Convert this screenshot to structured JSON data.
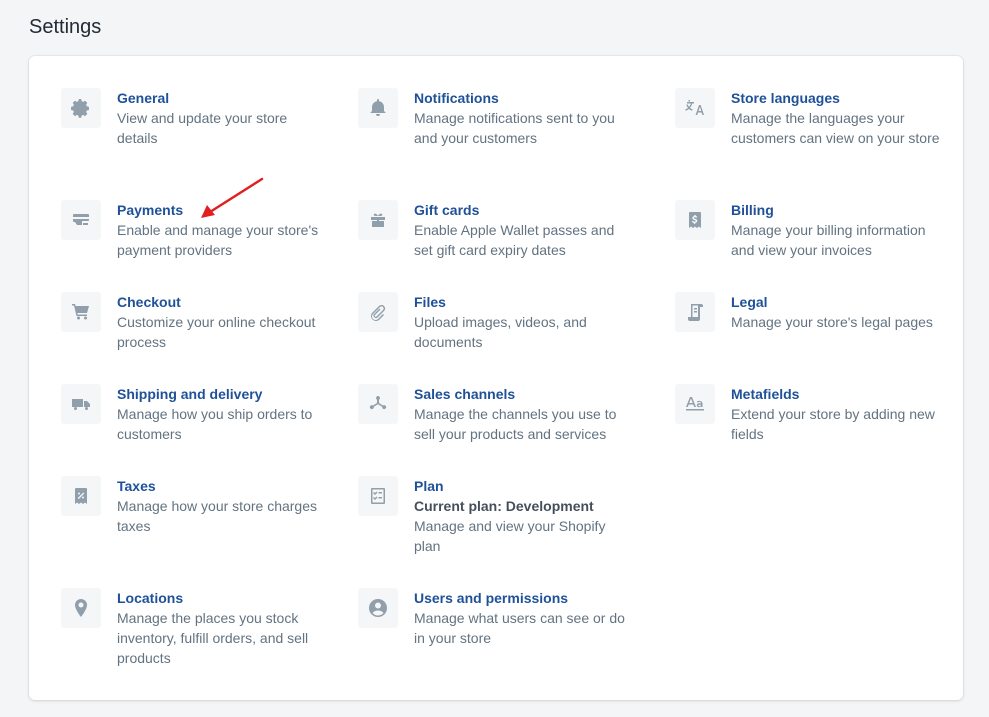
{
  "page": {
    "title": "Settings"
  },
  "items": [
    {
      "key": "general",
      "title": "General",
      "desc": "View and update your store details",
      "icon": "gear-icon"
    },
    {
      "key": "notifications",
      "title": "Notifications",
      "desc": "Manage notifications sent to you and your customers",
      "icon": "bell-icon"
    },
    {
      "key": "store-languages",
      "title": "Store languages",
      "desc": "Manage the languages your customers can view on your store",
      "icon": "translate-icon"
    },
    {
      "key": "payments",
      "title": "Payments",
      "desc": "Enable and manage your store's payment providers",
      "icon": "credit-card-icon"
    },
    {
      "key": "gift-cards",
      "title": "Gift cards",
      "desc": "Enable Apple Wallet passes and set gift card expiry dates",
      "icon": "gift-icon"
    },
    {
      "key": "billing",
      "title": "Billing",
      "desc": "Manage your billing information and view your invoices",
      "icon": "invoice-dollar-icon"
    },
    {
      "key": "checkout",
      "title": "Checkout",
      "desc": "Customize your online checkout process",
      "icon": "cart-icon"
    },
    {
      "key": "files",
      "title": "Files",
      "desc": "Upload images, videos, and documents",
      "icon": "paperclip-icon"
    },
    {
      "key": "legal",
      "title": "Legal",
      "desc": "Manage your store's legal pages",
      "icon": "legal-document-icon"
    },
    {
      "key": "shipping",
      "title": "Shipping and delivery",
      "desc": "Manage how you ship orders to customers",
      "icon": "truck-icon"
    },
    {
      "key": "sales-channels",
      "title": "Sales channels",
      "desc": "Manage the channels you use to sell your products and services",
      "icon": "channels-icon"
    },
    {
      "key": "metafields",
      "title": "Metafields",
      "desc": "Extend your store by adding new fields",
      "icon": "metafields-icon"
    },
    {
      "key": "taxes",
      "title": "Taxes",
      "desc": "Manage how your store charges taxes",
      "icon": "tax-receipt-icon"
    },
    {
      "key": "plan",
      "title": "Plan",
      "subtitle": "Current plan: Development",
      "desc": "Manage and view your Shopify plan",
      "icon": "plan-checklist-icon"
    },
    {
      "key": "locations",
      "title": "Locations",
      "desc": "Manage the places you stock inventory, fulfill orders, and sell products",
      "icon": "location-pin-icon"
    },
    {
      "key": "users",
      "title": "Users and permissions",
      "desc": "Manage what users can see or do in your store",
      "icon": "user-circle-icon"
    }
  ],
  "colors": {
    "link": "#1f5199",
    "description": "#637381",
    "icon": "#919eab",
    "arrow": "#e02020"
  }
}
